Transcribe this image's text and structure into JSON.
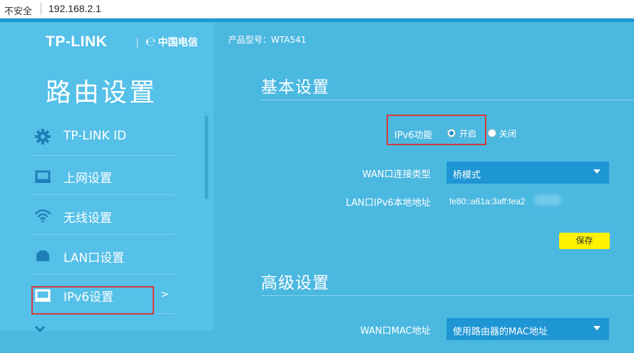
{
  "browser": {
    "security_label": "不安全",
    "url": "192.168.2.1"
  },
  "sidebar": {
    "brand": "TP-LINK",
    "partner": "中国电信",
    "title": "路由设置",
    "items": [
      {
        "label": "TP-LINK ID",
        "icon": "gear-icon"
      },
      {
        "label": "上网设置",
        "icon": "monitor-icon"
      },
      {
        "label": "无线设置",
        "icon": "wifi-icon"
      },
      {
        "label": "LAN口设置",
        "icon": "lan-icon"
      },
      {
        "label": "IPv6设置",
        "icon": "monitor-icon",
        "arrow": ">"
      },
      {
        "label": "",
        "icon": "more-icon"
      }
    ]
  },
  "main": {
    "model": "产品型号：WTA541",
    "basic": {
      "title": "基本设置",
      "ipv6_label": "IPv6功能",
      "ipv6_on": "开启",
      "ipv6_off": "关闭",
      "wan_label": "WAN口连接类型",
      "wan_value": "桥模式",
      "lan_label": "LAN口IPv6本地地址",
      "lan_value": "fe80::a61a:3aff:fea2",
      "save": "保存"
    },
    "advanced": {
      "title": "高级设置",
      "mac_label": "WAN口MAC地址",
      "mac_value": "使用路由器的MAC地址"
    }
  },
  "colors": {
    "sidebar_bg": "#55c0e8",
    "main_bg": "#4bb8e0",
    "accent": "#1f96d4",
    "save_button": "#fff200",
    "highlight_border": "#d43a3a"
  }
}
